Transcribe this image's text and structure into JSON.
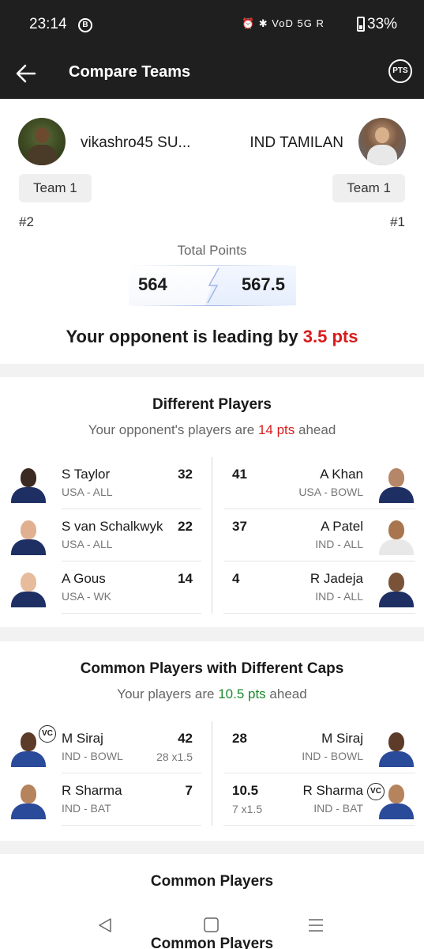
{
  "status_bar": {
    "time": "23:14",
    "b_icon": "B",
    "icons": "⏰ ✱ VoD 5G R",
    "battery": "33%"
  },
  "app_bar": {
    "title": "Compare Teams",
    "pts_badge": "PTS"
  },
  "header": {
    "left_user": {
      "name": "vikashro45 SU...",
      "team": "Team 1",
      "rank": "#2",
      "points": "564"
    },
    "right_user": {
      "name": "IND TAMILAN",
      "team": "Team 1",
      "rank": "#1",
      "points": "567.5"
    },
    "total_label": "Total Points",
    "lead_prefix": "Your opponent is leading by ",
    "lead_value": "3.5 pts"
  },
  "different_players": {
    "title": "Different Players",
    "sub_prefix": "Your opponent's players are ",
    "sub_value": "14 pts",
    "sub_suffix": " ahead",
    "left": [
      {
        "name": "S Taylor",
        "meta": "USA - ALL",
        "points": "32"
      },
      {
        "name": "S van Schalkwyk",
        "meta": "USA - ALL",
        "points": "22"
      },
      {
        "name": "A Gous",
        "meta": "USA - WK",
        "points": "14"
      }
    ],
    "right": [
      {
        "name": "A Khan",
        "meta": "USA - BOWL",
        "points": "41"
      },
      {
        "name": "A Patel",
        "meta": "IND - ALL",
        "points": "37"
      },
      {
        "name": "R Jadeja",
        "meta": "IND - ALL",
        "points": "4"
      }
    ]
  },
  "diff_caps": {
    "title": "Common Players with Different Caps",
    "sub_prefix": "Your players are ",
    "sub_value": "10.5 pts",
    "sub_suffix": " ahead",
    "left": [
      {
        "name": "M Siraj",
        "meta": "IND - BOWL",
        "points": "42",
        "mult": "28 x1.5",
        "cap": "VC"
      },
      {
        "name": "R Sharma",
        "meta": "IND - BAT",
        "points": "7"
      }
    ],
    "right": [
      {
        "name": "M Siraj",
        "meta": "IND - BOWL",
        "points": "28"
      },
      {
        "name": "R Sharma",
        "meta": "IND - BAT",
        "points": "10.5",
        "mult": "7 x1.5",
        "cap": "VC"
      }
    ]
  },
  "common_players": {
    "title": "Common Players",
    "peek_title": "Common Players"
  }
}
